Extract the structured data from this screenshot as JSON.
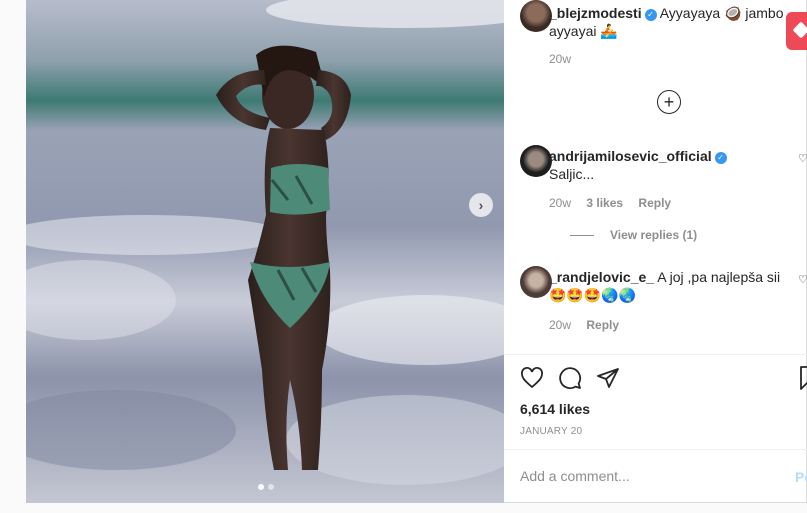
{
  "post": {
    "media_alt": "",
    "carousel": {
      "slides": 2,
      "active_index": 0
    },
    "caption": {
      "username": "_blejzmodesti",
      "verified": true,
      "text": "Ayyayaya 🥥 jambo ayyayai 🚣",
      "time": "20w"
    },
    "comments": [
      {
        "username": "andrijamilosevic_official",
        "verified": true,
        "text": "Saljic...",
        "time": "20w",
        "likes": "3 likes",
        "reply_label": "Reply",
        "view_replies": "View replies (1)"
      },
      {
        "username": "_randjelovic_e_",
        "verified": false,
        "text": "A joj ,pa najlepša sii🤩🤩🤩🌏🌏",
        "time": "20w",
        "reply_label": "Reply"
      }
    ],
    "likes": "6,614 likes",
    "date": "JANUARY 20",
    "add_comment": {
      "placeholder": "Add a comment...",
      "post_label": "Po"
    }
  },
  "icons": {
    "like": "heart-icon",
    "comment": "comment-icon",
    "share": "send-icon",
    "save": "bookmark-icon",
    "load_more": "plus-circle-icon",
    "next": "chevron-right-icon"
  },
  "colors": {
    "verified": "#3897f0",
    "post_button": "#b2dffc",
    "notification": "#ed4956"
  }
}
